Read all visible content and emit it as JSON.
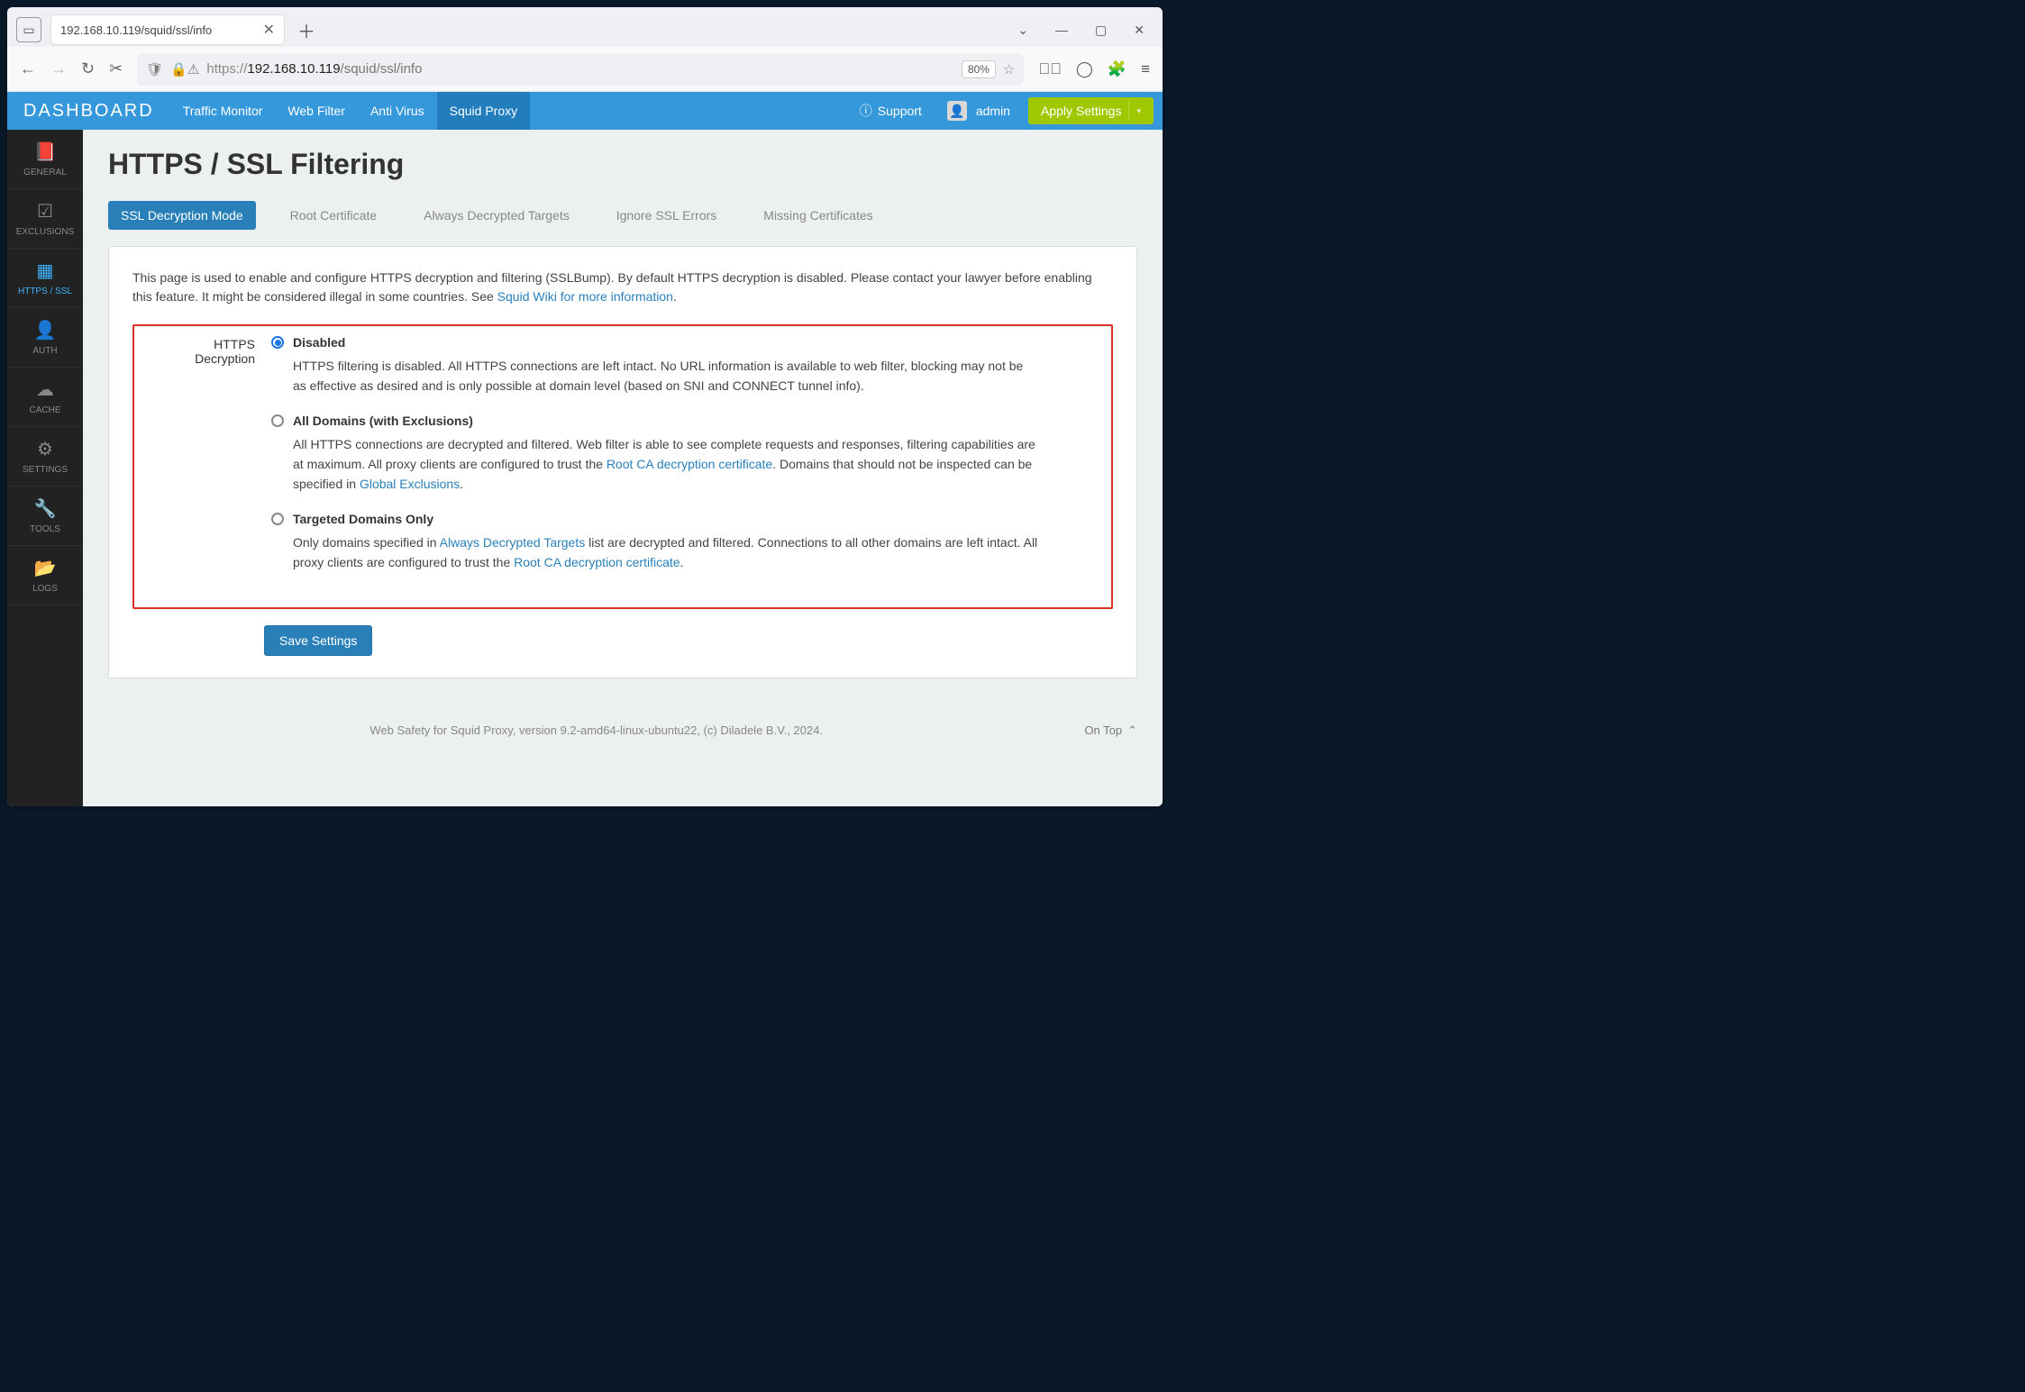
{
  "browser": {
    "tab_title": "192.168.10.119/squid/ssl/info",
    "url_prefix": "https://",
    "url_host": "192.168.10.119",
    "url_path": "/squid/ssl/info",
    "zoom": "80%"
  },
  "topnav": {
    "brand": "DASHBOARD",
    "items": [
      "Traffic Monitor",
      "Web Filter",
      "Anti Virus",
      "Squid Proxy"
    ],
    "active_index": 3,
    "support": "Support",
    "user": "admin",
    "apply": "Apply Settings"
  },
  "sidebar": {
    "items": [
      {
        "icon": "book-icon",
        "glyph": "📕",
        "label": "GENERAL"
      },
      {
        "icon": "check-icon",
        "glyph": "☑",
        "label": "EXCLUSIONS"
      },
      {
        "icon": "grid-icon",
        "glyph": "▦",
        "label": "HTTPS / SSL"
      },
      {
        "icon": "user-icon",
        "glyph": "👤",
        "label": "AUTH"
      },
      {
        "icon": "cloud-icon",
        "glyph": "☁",
        "label": "CACHE"
      },
      {
        "icon": "gear-icon",
        "glyph": "⚙",
        "label": "SETTINGS"
      },
      {
        "icon": "wrench-icon",
        "glyph": "🔧",
        "label": "TOOLS"
      },
      {
        "icon": "folder-icon",
        "glyph": "📂",
        "label": "LOGS"
      }
    ],
    "active_index": 2
  },
  "page": {
    "title": "HTTPS / SSL Filtering",
    "subtabs": [
      "SSL Decryption Mode",
      "Root Certificate",
      "Always Decrypted Targets",
      "Ignore SSL Errors",
      "Missing Certificates"
    ],
    "active_subtab": 0,
    "intro_pre": "This page is used to enable and configure HTTPS decryption and filtering (SSLBump). By default HTTPS decryption is disabled. Please contact your lawyer before enabling this feature. It might be considered illegal in some countries. See ",
    "intro_link": "Squid Wiki for more information",
    "intro_post": "."
  },
  "form": {
    "label": "HTTPS Decryption",
    "selected": 0,
    "options": [
      {
        "title": "Disabled",
        "desc_parts": [
          {
            "t": "HTTPS filtering is disabled. All HTTPS connections are left intact. No URL information is available to web filter, blocking may not be as effective as desired and is only possible at domain level (based on SNI and CONNECT tunnel info)."
          }
        ]
      },
      {
        "title": "All Domains (with Exclusions)",
        "desc_parts": [
          {
            "t": "All HTTPS connections are decrypted and filtered. Web filter is able to see complete requests and responses, filtering capabilities are at maximum. All proxy clients are configured to trust the "
          },
          {
            "t": "Root CA decryption certificate",
            "link": true
          },
          {
            "t": ". Domains that should not be inspected can be specified in "
          },
          {
            "t": "Global Exclusions",
            "link": true
          },
          {
            "t": "."
          }
        ]
      },
      {
        "title": "Targeted Domains Only",
        "desc_parts": [
          {
            "t": "Only domains specified in "
          },
          {
            "t": "Always Decrypted Targets",
            "link": true
          },
          {
            "t": " list are decrypted and filtered. Connections to all other domains are left intact. All proxy clients are configured to trust the "
          },
          {
            "t": "Root CA decryption certificate",
            "link": true
          },
          {
            "t": "."
          }
        ]
      }
    ],
    "save": "Save Settings"
  },
  "footer": {
    "text": "Web Safety for Squid Proxy, version 9.2-amd64-linux-ubuntu22, (c) Diladele B.V., 2024.",
    "ontop": "On Top"
  }
}
